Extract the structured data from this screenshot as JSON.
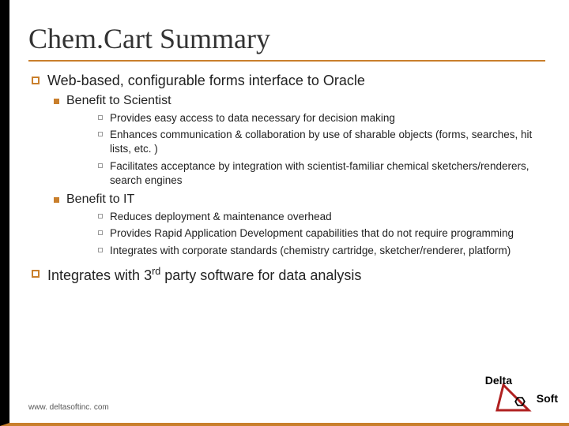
{
  "title": "Chem.Cart Summary",
  "b1": {
    "text": "Web-based, configurable forms interface to Oracle",
    "sub1": {
      "text": "Benefit to Scientist",
      "items": [
        "Provides easy access to data necessary for decision making",
        "Enhances communication & collaboration by use of sharable objects (forms, searches, hit lists, etc. )",
        "Facilitates acceptance by integration with scientist-familiar chemical sketchers/renderers, search engines"
      ]
    },
    "sub2": {
      "text": "Benefit to IT",
      "items": [
        "Reduces deployment & maintenance overhead",
        "Provides Rapid Application Development capabilities that do not require programming",
        "Integrates with corporate standards (chemistry cartridge, sketcher/renderer, platform)"
      ]
    }
  },
  "b2_pre": "Integrates with 3",
  "b2_sup": "rd",
  "b2_post": " party software for data analysis",
  "footer": "www. deltasoftinc. com",
  "logo": {
    "delta": "Delta",
    "soft": "Soft"
  }
}
